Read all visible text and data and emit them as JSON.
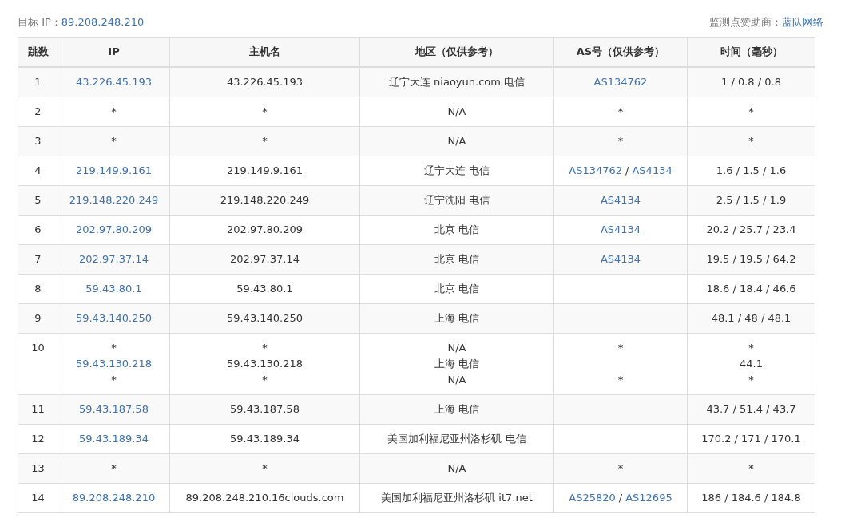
{
  "target": {
    "label": "目标 IP：",
    "value": "89.208.248.210"
  },
  "sponsor": {
    "label": "监测点赞助商：",
    "value": "蓝队网络"
  },
  "columns": [
    "跳数",
    "IP",
    "主机名",
    "地区（仅供参考）",
    "AS号（仅供参考）",
    "时间（毫秒）"
  ],
  "rows": [
    {
      "hop": "1",
      "ip": [
        [
          {
            "kind": "link",
            "text": "43.226.45.193"
          }
        ]
      ],
      "host": [
        [
          {
            "kind": "text",
            "text": "43.226.45.193"
          }
        ]
      ],
      "region": [
        [
          {
            "kind": "text",
            "text": "辽宁大连 niaoyun.com 电信"
          }
        ]
      ],
      "as": [
        [
          {
            "kind": "link",
            "text": "AS134762"
          }
        ]
      ],
      "time": [
        [
          {
            "kind": "text",
            "text": "1 / 0.8 / 0.8"
          }
        ]
      ]
    },
    {
      "hop": "2",
      "ip": [
        [
          {
            "kind": "text",
            "text": "*"
          }
        ]
      ],
      "host": [
        [
          {
            "kind": "text",
            "text": "*"
          }
        ]
      ],
      "region": [
        [
          {
            "kind": "text",
            "text": "N/A"
          }
        ]
      ],
      "as": [
        [
          {
            "kind": "text",
            "text": "*"
          }
        ]
      ],
      "time": [
        [
          {
            "kind": "text",
            "text": "*"
          }
        ]
      ]
    },
    {
      "hop": "3",
      "ip": [
        [
          {
            "kind": "text",
            "text": "*"
          }
        ]
      ],
      "host": [
        [
          {
            "kind": "text",
            "text": "*"
          }
        ]
      ],
      "region": [
        [
          {
            "kind": "text",
            "text": "N/A"
          }
        ]
      ],
      "as": [
        [
          {
            "kind": "text",
            "text": "*"
          }
        ]
      ],
      "time": [
        [
          {
            "kind": "text",
            "text": "*"
          }
        ]
      ]
    },
    {
      "hop": "4",
      "ip": [
        [
          {
            "kind": "link",
            "text": "219.149.9.161"
          }
        ]
      ],
      "host": [
        [
          {
            "kind": "text",
            "text": "219.149.9.161"
          }
        ]
      ],
      "region": [
        [
          {
            "kind": "text",
            "text": "辽宁大连 电信"
          }
        ]
      ],
      "as": [
        [
          {
            "kind": "link",
            "text": "AS134762"
          },
          {
            "kind": "text",
            "text": "/"
          },
          {
            "kind": "link",
            "text": "AS4134"
          }
        ]
      ],
      "time": [
        [
          {
            "kind": "text",
            "text": "1.6 / 1.5 / 1.6"
          }
        ]
      ]
    },
    {
      "hop": "5",
      "ip": [
        [
          {
            "kind": "link",
            "text": "219.148.220.249"
          }
        ]
      ],
      "host": [
        [
          {
            "kind": "text",
            "text": "219.148.220.249"
          }
        ]
      ],
      "region": [
        [
          {
            "kind": "text",
            "text": "辽宁沈阳 电信"
          }
        ]
      ],
      "as": [
        [
          {
            "kind": "link",
            "text": "AS4134"
          }
        ]
      ],
      "time": [
        [
          {
            "kind": "text",
            "text": "2.5 / 1.5 / 1.9"
          }
        ]
      ]
    },
    {
      "hop": "6",
      "ip": [
        [
          {
            "kind": "link",
            "text": "202.97.80.209"
          }
        ]
      ],
      "host": [
        [
          {
            "kind": "text",
            "text": "202.97.80.209"
          }
        ]
      ],
      "region": [
        [
          {
            "kind": "text",
            "text": "北京 电信"
          }
        ]
      ],
      "as": [
        [
          {
            "kind": "link",
            "text": "AS4134"
          }
        ]
      ],
      "time": [
        [
          {
            "kind": "text",
            "text": "20.2 / 25.7 / 23.4"
          }
        ]
      ]
    },
    {
      "hop": "7",
      "ip": [
        [
          {
            "kind": "link",
            "text": "202.97.37.14"
          }
        ]
      ],
      "host": [
        [
          {
            "kind": "text",
            "text": "202.97.37.14"
          }
        ]
      ],
      "region": [
        [
          {
            "kind": "text",
            "text": "北京 电信"
          }
        ]
      ],
      "as": [
        [
          {
            "kind": "link",
            "text": "AS4134"
          }
        ]
      ],
      "time": [
        [
          {
            "kind": "text",
            "text": "19.5 / 19.5 / 64.2"
          }
        ]
      ]
    },
    {
      "hop": "8",
      "ip": [
        [
          {
            "kind": "link",
            "text": "59.43.80.1"
          }
        ]
      ],
      "host": [
        [
          {
            "kind": "text",
            "text": "59.43.80.1"
          }
        ]
      ],
      "region": [
        [
          {
            "kind": "text",
            "text": "北京 电信"
          }
        ]
      ],
      "time": [
        [
          {
            "kind": "text",
            "text": "18.6 / 18.4 / 46.6"
          }
        ]
      ]
    },
    {
      "hop": "9",
      "ip": [
        [
          {
            "kind": "link",
            "text": "59.43.140.250"
          }
        ]
      ],
      "host": [
        [
          {
            "kind": "text",
            "text": "59.43.140.250"
          }
        ]
      ],
      "region": [
        [
          {
            "kind": "text",
            "text": "上海 电信"
          }
        ]
      ],
      "time": [
        [
          {
            "kind": "text",
            "text": "48.1 / 48 / 48.1"
          }
        ]
      ]
    },
    {
      "hop": "10",
      "ip": [
        [
          {
            "kind": "text",
            "text": "*"
          }
        ],
        [
          {
            "kind": "link",
            "text": "59.43.130.218"
          }
        ],
        [
          {
            "kind": "text",
            "text": "*"
          }
        ]
      ],
      "host": [
        [
          {
            "kind": "text",
            "text": "*"
          }
        ],
        [
          {
            "kind": "text",
            "text": "59.43.130.218"
          }
        ],
        [
          {
            "kind": "text",
            "text": "*"
          }
        ]
      ],
      "region": [
        [
          {
            "kind": "text",
            "text": "N/A"
          }
        ],
        [
          {
            "kind": "text",
            "text": "上海 电信"
          }
        ],
        [
          {
            "kind": "text",
            "text": "N/A"
          }
        ]
      ],
      "as": [
        [
          {
            "kind": "text",
            "text": "*"
          }
        ],
        [
          {
            "kind": "blank"
          }
        ],
        [
          {
            "kind": "text",
            "text": "*"
          }
        ]
      ],
      "time": [
        [
          {
            "kind": "text",
            "text": "*"
          }
        ],
        [
          {
            "kind": "text",
            "text": "44.1"
          }
        ],
        [
          {
            "kind": "text",
            "text": "*"
          }
        ]
      ]
    },
    {
      "hop": "11",
      "ip": [
        [
          {
            "kind": "link",
            "text": "59.43.187.58"
          }
        ]
      ],
      "host": [
        [
          {
            "kind": "text",
            "text": "59.43.187.58"
          }
        ]
      ],
      "region": [
        [
          {
            "kind": "text",
            "text": "上海 电信"
          }
        ]
      ],
      "time": [
        [
          {
            "kind": "text",
            "text": "43.7 / 51.4 / 43.7"
          }
        ]
      ]
    },
    {
      "hop": "12",
      "ip": [
        [
          {
            "kind": "link",
            "text": "59.43.189.34"
          }
        ]
      ],
      "host": [
        [
          {
            "kind": "text",
            "text": "59.43.189.34"
          }
        ]
      ],
      "region": [
        [
          {
            "kind": "text",
            "text": "美国加利福尼亚州洛杉矶 电信"
          }
        ]
      ],
      "time": [
        [
          {
            "kind": "text",
            "text": "170.2 / 171 / 170.1"
          }
        ]
      ]
    },
    {
      "hop": "13",
      "ip": [
        [
          {
            "kind": "text",
            "text": "*"
          }
        ]
      ],
      "host": [
        [
          {
            "kind": "text",
            "text": "*"
          }
        ]
      ],
      "region": [
        [
          {
            "kind": "text",
            "text": "N/A"
          }
        ]
      ],
      "as": [
        [
          {
            "kind": "text",
            "text": "*"
          }
        ]
      ],
      "time": [
        [
          {
            "kind": "text",
            "text": "*"
          }
        ]
      ]
    },
    {
      "hop": "14",
      "ip": [
        [
          {
            "kind": "link",
            "text": "89.208.248.210"
          }
        ]
      ],
      "host": [
        [
          {
            "kind": "text",
            "text": "89.208.248.210.16clouds.com"
          }
        ]
      ],
      "region": [
        [
          {
            "kind": "text",
            "text": "美国加利福尼亚州洛杉矶 it7.net"
          }
        ]
      ],
      "as": [
        [
          {
            "kind": "link",
            "text": "AS25820"
          },
          {
            "kind": "text",
            "text": "/"
          },
          {
            "kind": "link",
            "text": "AS12695"
          }
        ]
      ],
      "time": [
        [
          {
            "kind": "text",
            "text": "186 / 184.6 / 184.8"
          }
        ]
      ]
    }
  ]
}
